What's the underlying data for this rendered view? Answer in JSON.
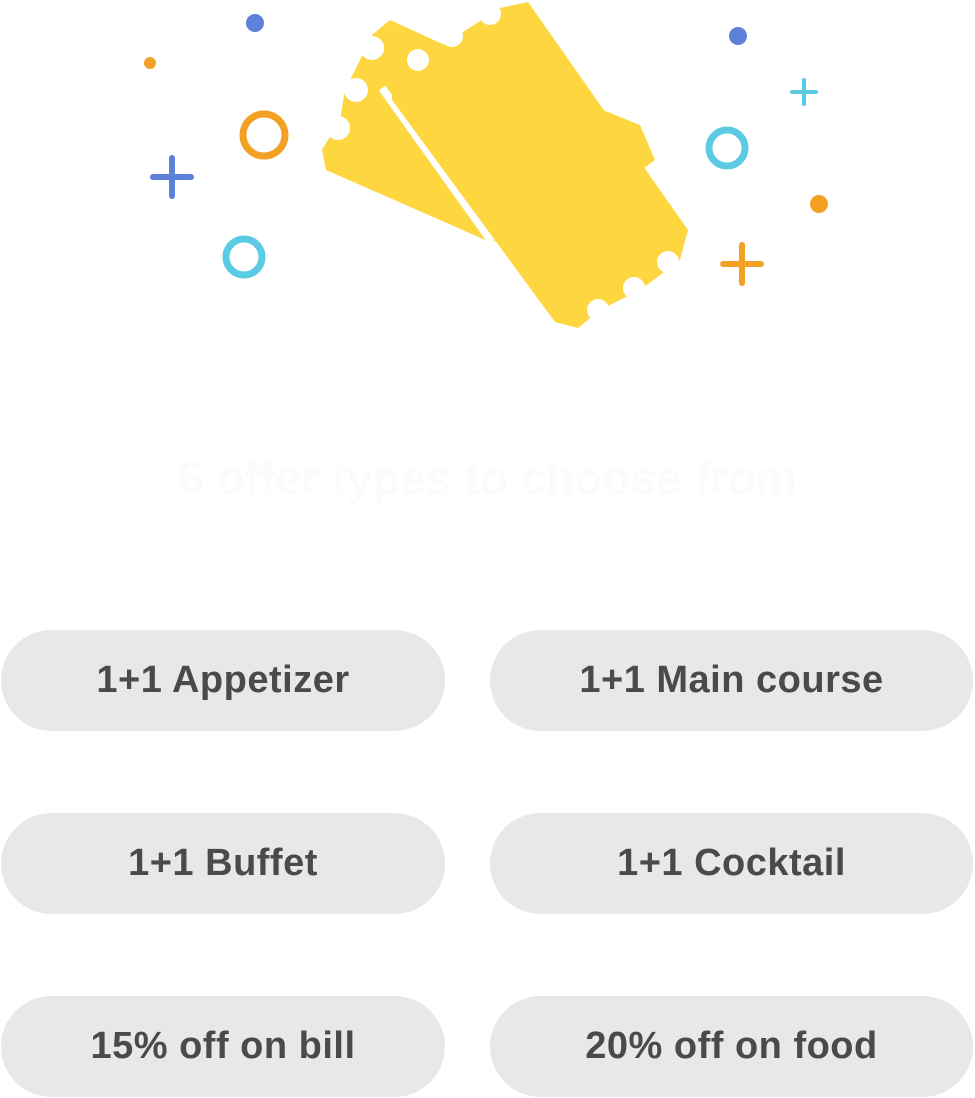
{
  "illustration": {
    "icon": "tickets-icon",
    "ticket_color": "#fdd640",
    "confetti_colors": {
      "blue": "#5d80d8",
      "orange": "#f3a124",
      "cyan": "#5bcbe3"
    }
  },
  "headline": "6 offer types to choose from",
  "offers": [
    {
      "label": "1+1 Appetizer"
    },
    {
      "label": "1+1 Main course"
    },
    {
      "label": "1+1 Buffet"
    },
    {
      "label": "1+1 Cocktail"
    },
    {
      "label": "15% off on bill"
    },
    {
      "label": "20% off on food"
    }
  ],
  "colors": {
    "pill_background": "#e8e8e8",
    "pill_text": "#4a4a4a",
    "headline_text": "#fbfbfb"
  }
}
